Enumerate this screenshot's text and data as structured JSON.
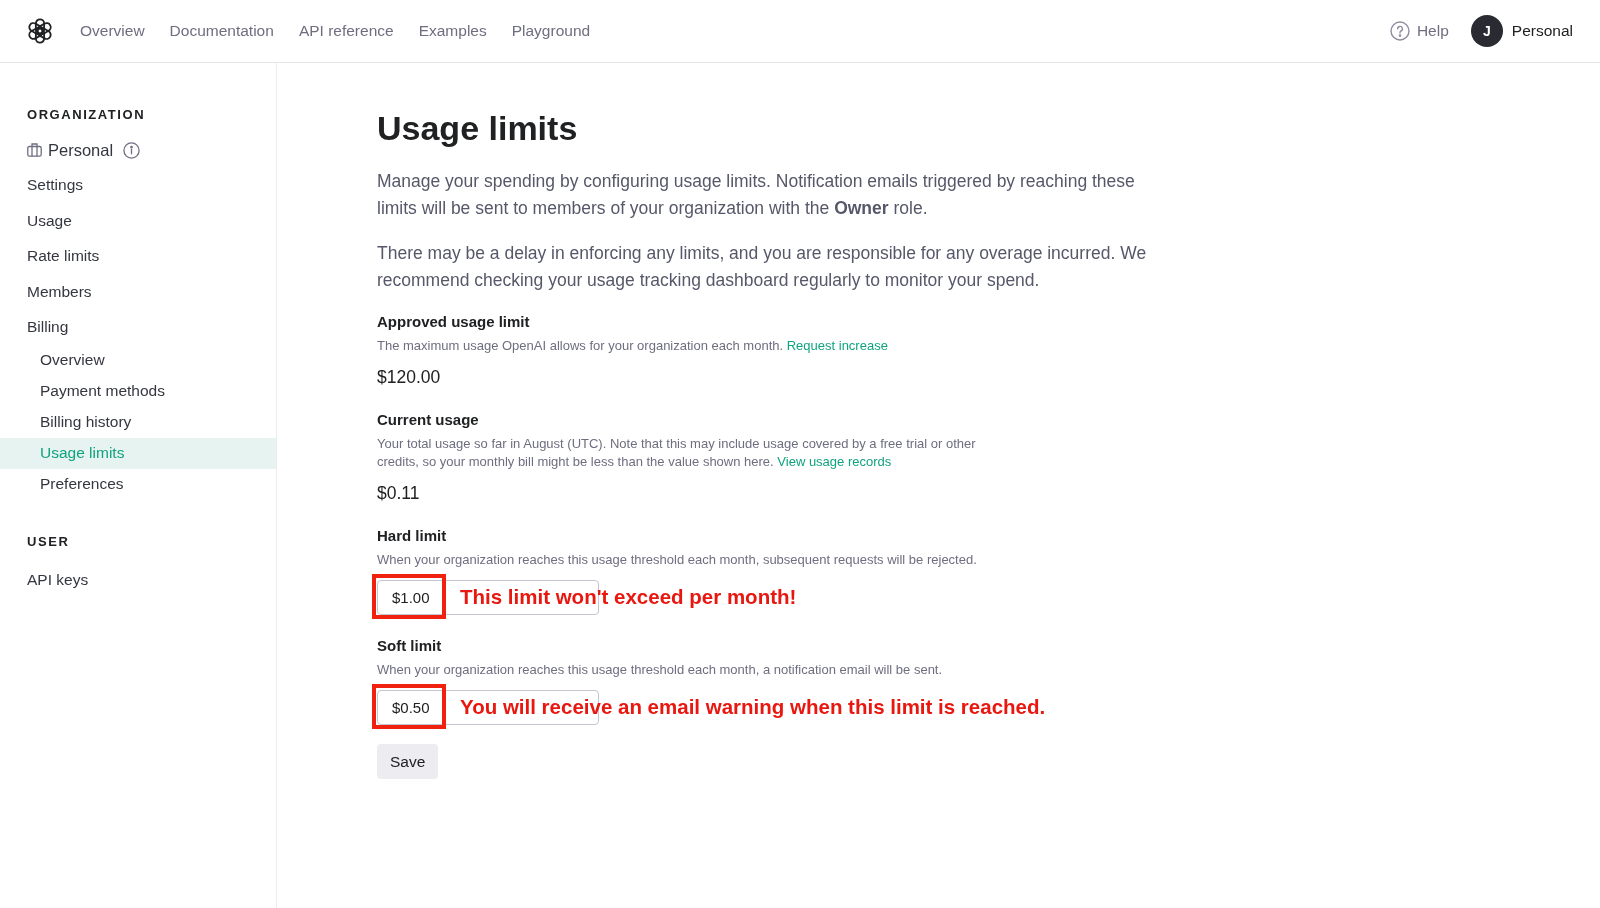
{
  "nav": {
    "links": [
      {
        "label": "Overview"
      },
      {
        "label": "Documentation"
      },
      {
        "label": "API reference"
      },
      {
        "label": "Examples"
      },
      {
        "label": "Playground"
      }
    ],
    "help": {
      "label": "Help"
    },
    "account": {
      "initial": "J",
      "label": "Personal"
    }
  },
  "sidebar": {
    "sections": [
      {
        "heading": "ORGANIZATION",
        "org": {
          "label": "Personal"
        },
        "items": [
          {
            "label": "Settings",
            "selected": false
          },
          {
            "label": "Usage",
            "selected": false
          },
          {
            "label": "Rate limits",
            "selected": false
          },
          {
            "label": "Members",
            "selected": false
          },
          {
            "label": "Billing",
            "selected": false,
            "children": [
              {
                "label": "Overview",
                "selected": false
              },
              {
                "label": "Payment methods",
                "selected": false
              },
              {
                "label": "Billing history",
                "selected": false
              },
              {
                "label": "Usage limits",
                "selected": true
              },
              {
                "label": "Preferences",
                "selected": false
              }
            ]
          }
        ]
      },
      {
        "heading": "USER",
        "items": [
          {
            "label": "API keys",
            "selected": false
          }
        ]
      }
    ]
  },
  "main": {
    "title": "Usage limits",
    "paragraphs": [
      "Manage your spending by configuring usage limits. Notification emails triggered by reaching these limits will be sent to members of your organization with the **Owner** role.",
      "There may be a delay in enforcing any limits, and you are responsible for any overage incurred. We recommend checking your usage tracking dashboard regularly to monitor your spend."
    ],
    "sections": [
      {
        "kind": "value",
        "heading": "Approved usage limit",
        "description": "The maximum usage OpenAI allows for your organization each month.",
        "link": "Request increase",
        "value": "$120.00"
      },
      {
        "kind": "value",
        "heading": "Current usage",
        "description": "Your total usage so far in August (UTC). Note that this may include usage covered by a free trial or other credits, so your monthly bill might be less than the value shown here.",
        "link": "View usage records",
        "value": "$0.11"
      },
      {
        "kind": "input",
        "heading": "Hard limit",
        "description": "When your organization reaches this usage threshold each month, subsequent requests will be rejected.",
        "value": "$1.00",
        "highlighted": true,
        "annotation": "This limit won't exceed per month!"
      },
      {
        "kind": "input",
        "heading": "Soft limit",
        "description": "When your organization reaches this usage threshold each month, a notification email will be sent.",
        "value": "$0.50",
        "highlighted": true,
        "annotation": "You will receive an email warning when this limit is reached."
      }
    ],
    "save_button": "Save"
  }
}
